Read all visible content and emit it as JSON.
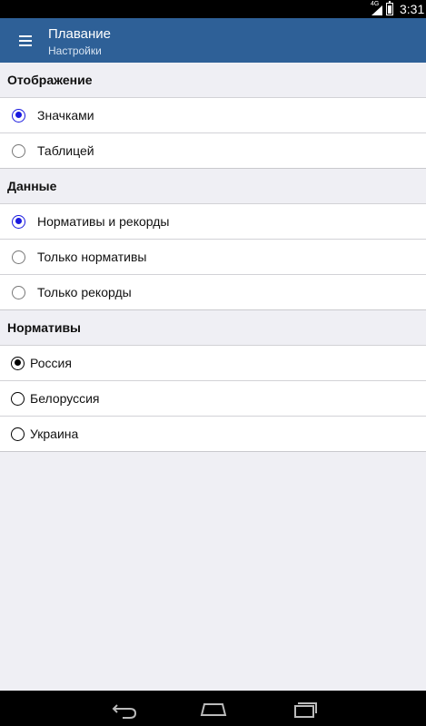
{
  "status_bar": {
    "network": "4G",
    "time": "3:31"
  },
  "app_bar": {
    "menu_icon": "menu-icon",
    "title": "Плавание",
    "subtitle": "Настройки"
  },
  "sections": [
    {
      "header": "Отображение",
      "options": [
        {
          "label": "Значками",
          "checked": true
        },
        {
          "label": "Таблицей",
          "checked": false
        }
      ]
    },
    {
      "header": "Данные",
      "options": [
        {
          "label": "Нормативы и рекорды",
          "checked": true
        },
        {
          "label": "Только нормативы",
          "checked": false
        },
        {
          "label": "Только рекорды",
          "checked": false
        }
      ]
    },
    {
      "header": "Нормативы",
      "options": [
        {
          "label": "Россия",
          "checked": true
        },
        {
          "label": "Белоруссия",
          "checked": false
        },
        {
          "label": "Украина",
          "checked": false
        }
      ]
    }
  ],
  "nav_bar": {
    "back_icon": "back-icon",
    "home_icon": "home-icon",
    "recents_icon": "recents-icon"
  },
  "colors": {
    "app_bar": "#2e6097",
    "accent_radio": "#1a1adf",
    "background": "#efeff4"
  }
}
